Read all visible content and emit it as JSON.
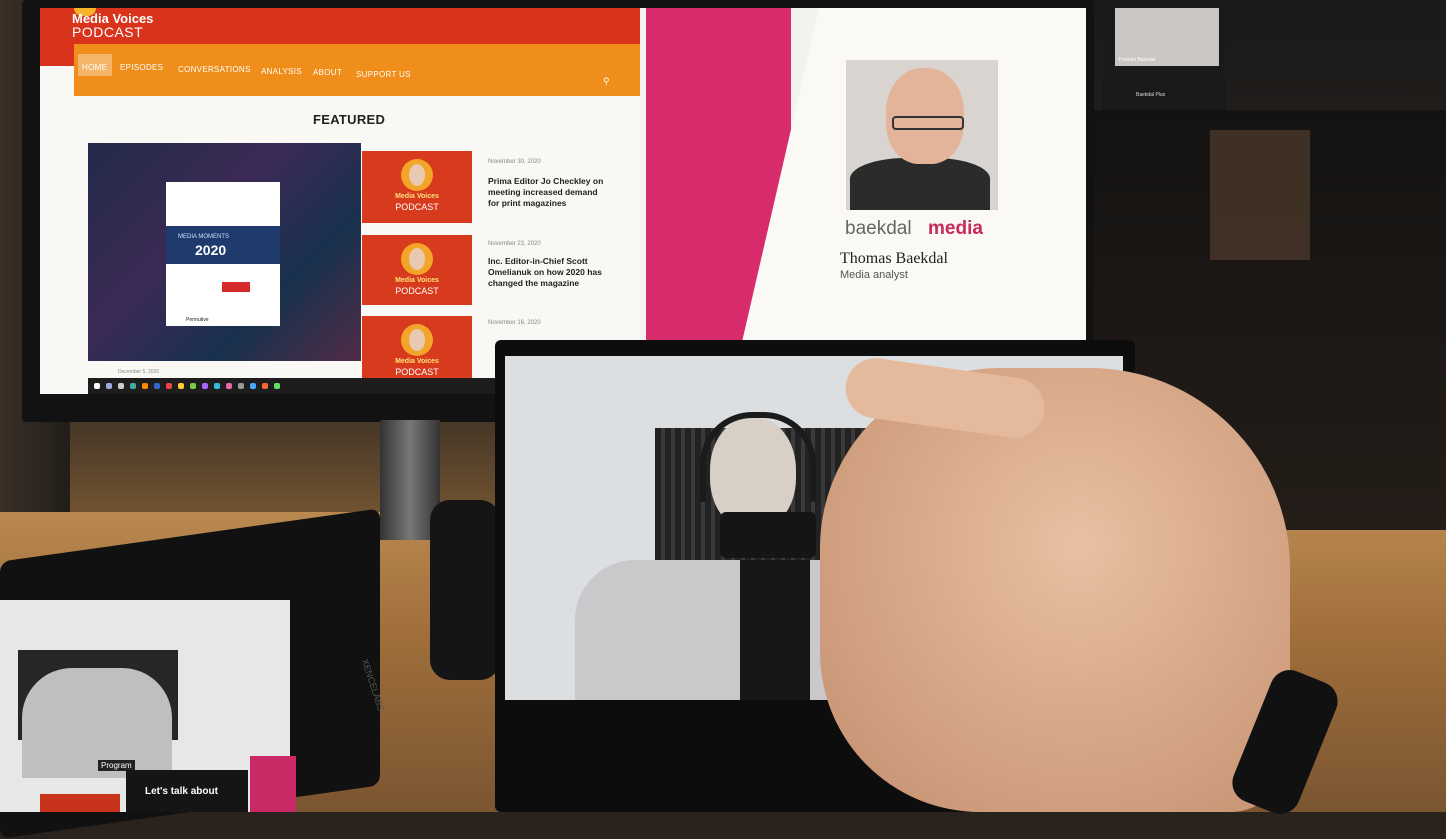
{
  "website": {
    "brand_line1": "Media Voices",
    "brand_line2": "PODCAST",
    "nav": [
      "HOME",
      "EPISODES",
      "CONVERSATIONS",
      "ANALYSIS",
      "ABOUT",
      "SUPPORT US"
    ],
    "featured_heading": "FEATURED",
    "cover": {
      "subtitle": "MEDIA MOMENTS",
      "year": "2020",
      "sponsor": "Permutive",
      "date": "December 5, 2020"
    },
    "thumb_label_top": "Media Voices",
    "thumb_label_bottom": "PODCAST",
    "posts": [
      {
        "date": "November 30, 2020",
        "title": "Prima Editor Jo Checkley on meeting increased demand for print magazines"
      },
      {
        "date": "November 23, 2020",
        "title": "Inc. Editor-in-Chief Scott Omelianuk on how 2020 has changed the magazine"
      },
      {
        "date": "November 16, 2020",
        "title": ""
      }
    ]
  },
  "profile": {
    "brand_light": "baekdal",
    "brand_bold": "media",
    "name": "Thomas Baekdal",
    "role": "Media analyst"
  },
  "zoom": {
    "participant": "Thomas Baekdal",
    "window_label": "Baekdal Plus"
  },
  "tablet": {
    "program_label": "Program",
    "headline": "Let's talk about",
    "brand": "XENCELABS"
  },
  "colors": {
    "podcast_red": "#d9331c",
    "podcast_orange": "#ef8e1b",
    "baekdal_pink": "#d72b6c"
  }
}
